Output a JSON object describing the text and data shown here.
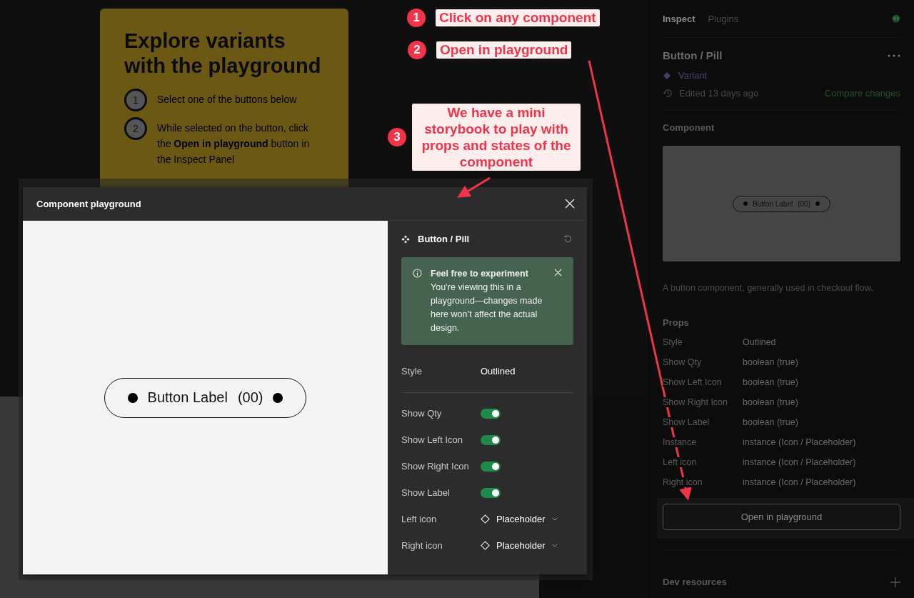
{
  "annotations": [
    {
      "number": "1",
      "text": "Click on any component"
    },
    {
      "number": "2",
      "text": "Open in playground"
    },
    {
      "number": "3",
      "text": "We have a mini storybook to play with props and states of the component"
    }
  ],
  "canvas": {
    "card": {
      "title": "Explore variants with the playground",
      "steps": [
        {
          "number": "1",
          "text": "Select one of the buttons below"
        },
        {
          "number": "2",
          "text": "While selected on the button, click the **Open in playground** button in the Inspect Panel"
        }
      ]
    }
  },
  "modal": {
    "title": "Component playground",
    "preview": {
      "label": "Button Label",
      "qty": "(00)"
    },
    "props_panel": {
      "component": "Button / Pill",
      "notice": {
        "title": "Feel free to experiment",
        "body": "You’re viewing this in a playground—changes made here won’t affect the actual design."
      },
      "style": {
        "label": "Style",
        "value": "Outlined"
      },
      "toggles": [
        {
          "label": "Show Qty",
          "on": true
        },
        {
          "label": "Show Left Icon",
          "on": true
        },
        {
          "label": "Show Right Icon",
          "on": true
        },
        {
          "label": "Show Label",
          "on": true
        }
      ],
      "selects": [
        {
          "label": "Left icon",
          "value": "Placeholder"
        },
        {
          "label": "Right icon",
          "value": "Placeholder"
        }
      ]
    }
  },
  "inspect_panel": {
    "tabs": [
      {
        "label": "Inspect",
        "selected": true
      },
      {
        "label": "Plugins",
        "selected": false
      }
    ],
    "title": "Button / Pill",
    "variant": "Variant",
    "edited": "Edited 13 days ago",
    "compare_link": "Compare changes",
    "section_title": "Component",
    "preview": {
      "label": "Button Label",
      "qty": "(00)"
    },
    "description": "A button component, generally used in checkout flow.",
    "props_title": "Props",
    "props": [
      {
        "name": "Style",
        "value": "Outlined"
      },
      {
        "name": "Show Qty",
        "value": "boolean (true)"
      },
      {
        "name": "Show Left Icon",
        "value": "boolean (true)"
      },
      {
        "name": "Show Right Icon",
        "value": "boolean (true)"
      },
      {
        "name": "Show Label",
        "value": "boolean (true)"
      },
      {
        "name": "Instance",
        "value": "instance (Icon / Placeholder)"
      },
      {
        "name": "Left icon",
        "value": "instance (Icon / Placeholder)"
      },
      {
        "name": "Right icon",
        "value": "instance (Icon / Placeholder)"
      }
    ],
    "open_button": "Open in playground",
    "dev_resources": "Dev resources"
  }
}
